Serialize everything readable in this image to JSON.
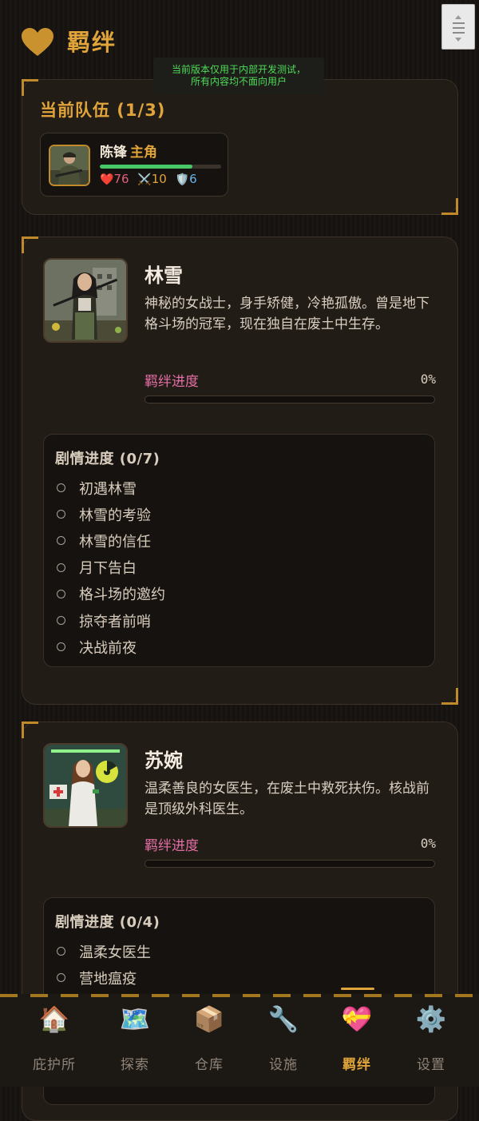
{
  "header": {
    "title": "羁绊",
    "notice_line1": "当前版本仅用于内部开发测试，",
    "notice_line2": "所有内容均不面向用户"
  },
  "team": {
    "title": "当前队伍 (1/3)",
    "member": {
      "name": "陈锋",
      "role": "主角",
      "hp_fraction": 0.76,
      "hp": "76",
      "attack": "10",
      "defense": "6",
      "hp_icon": "❤️",
      "attack_icon": "⚔️",
      "defense_icon": "🛡️"
    }
  },
  "characters": [
    {
      "name": "林雪",
      "description": "神秘的女战士，身手矫健，冷艳孤傲。曾是地下格斗场的冠军，现在独自在废土中生存。",
      "bond_label": "羁绊进度",
      "bond_percent": "0%",
      "bond_value": 0,
      "story_title": "剧情进度 (0/7)",
      "story": [
        "初遇林雪",
        "林雪的考验",
        "林雪的信任",
        "月下告白",
        "格斗场的邀约",
        "掠夺者前哨",
        "决战前夜"
      ]
    },
    {
      "name": "苏婉",
      "description": "温柔善良的女医生，在废土中救死扶伤。核战前是顶级外科医生。",
      "bond_label": "羁绊进度",
      "bond_percent": "0%",
      "bond_value": 0,
      "story_title": "剧情进度 (0/4)",
      "story": [
        "温柔女医生",
        "营地瘟疫"
      ]
    }
  ],
  "tabs": [
    {
      "label": "庇护所",
      "icon": "🏠"
    },
    {
      "label": "探索",
      "icon": "🗺️"
    },
    {
      "label": "仓库",
      "icon": "📦"
    },
    {
      "label": "设施",
      "icon": "🔧"
    },
    {
      "label": "羁绊",
      "icon": "💝",
      "active": true
    },
    {
      "label": "设置",
      "icon": "⚙️"
    }
  ],
  "colors": {
    "accent": "#e0a43a",
    "bond": "#e46fa6",
    "hp": "#47c767"
  }
}
